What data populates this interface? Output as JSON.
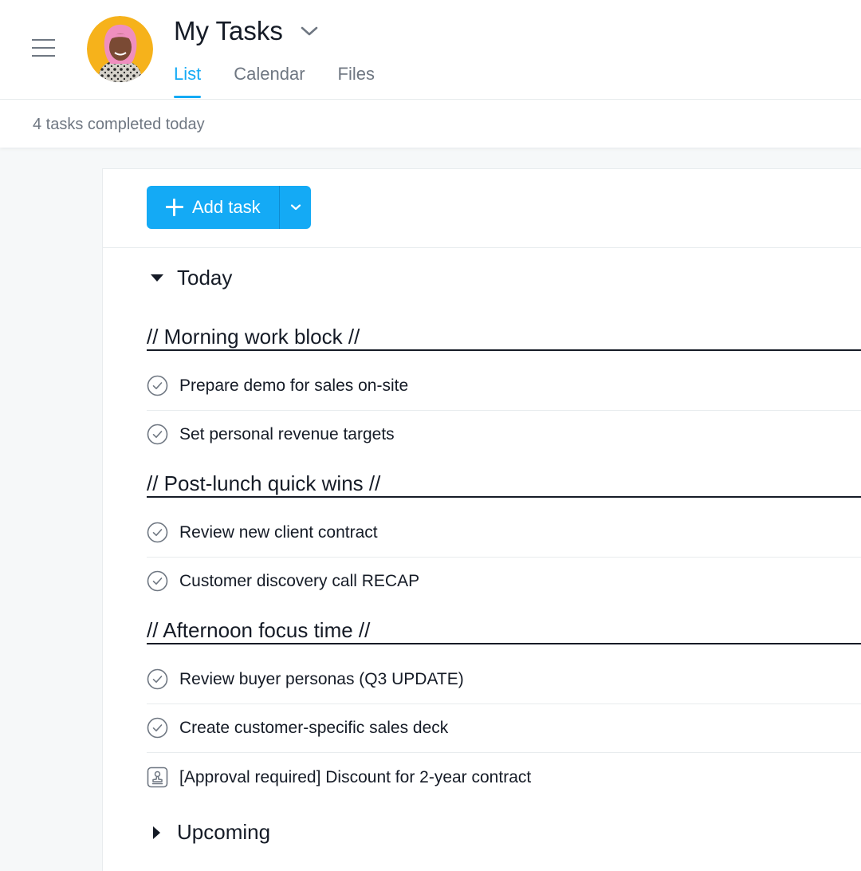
{
  "header": {
    "title": "My Tasks",
    "tabs": [
      {
        "label": "List",
        "active": true
      },
      {
        "label": "Calendar",
        "active": false
      },
      {
        "label": "Files",
        "active": false
      }
    ]
  },
  "status": {
    "completed_text": "4 tasks completed today"
  },
  "toolbar": {
    "add_task_label": "Add task"
  },
  "sections": {
    "today": {
      "title": "Today",
      "groups": [
        {
          "title": "// Morning work block //",
          "tasks": [
            {
              "name": "Prepare demo for sales on-site",
              "icon": "check-circle-icon"
            },
            {
              "name": "Set personal revenue targets",
              "icon": "check-circle-icon"
            }
          ]
        },
        {
          "title": "// Post-lunch quick wins //",
          "tasks": [
            {
              "name": "Review new client contract",
              "icon": "check-circle-icon"
            },
            {
              "name": "Customer discovery call RECAP",
              "icon": "check-circle-icon"
            }
          ]
        },
        {
          "title": "// Afternoon focus time //",
          "tasks": [
            {
              "name": "Review buyer personas (Q3 UPDATE)",
              "icon": "check-circle-icon"
            },
            {
              "name": "Create customer-specific sales deck",
              "icon": "check-circle-icon"
            },
            {
              "name": "[Approval required] Discount for 2-year contract",
              "icon": "approval-stamp-icon"
            }
          ]
        }
      ]
    },
    "upcoming": {
      "title": "Upcoming"
    }
  },
  "colors": {
    "accent": "#14aaf5",
    "text": "#151b26",
    "muted": "#6f7782",
    "divider": "#e8ecee",
    "background": "#f6f8f9"
  }
}
